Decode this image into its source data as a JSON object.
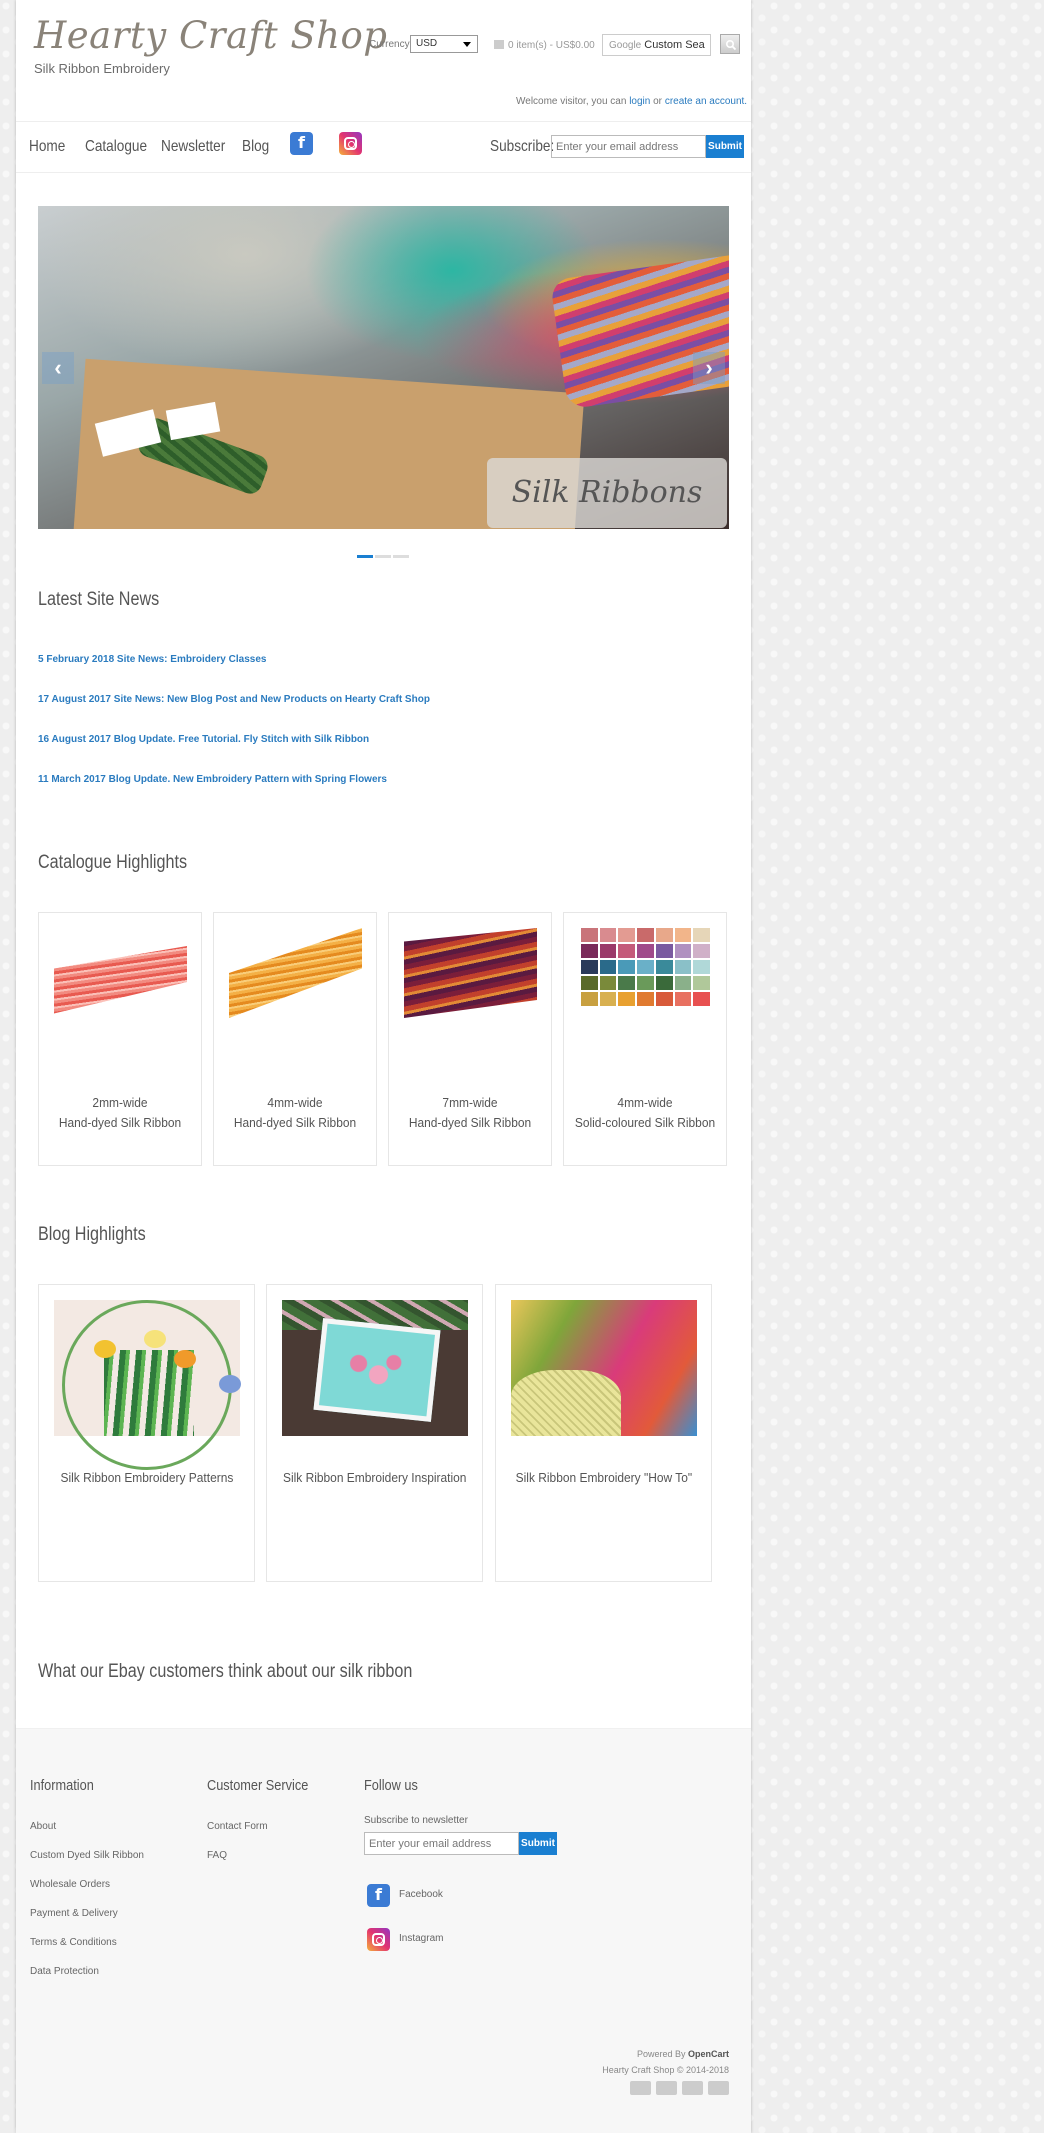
{
  "header": {
    "logo": "Hearty Craft Shop",
    "tagline": "Silk Ribbon Embroidery",
    "currency_label": "Currency:",
    "currency_value": "USD",
    "cart": "0 item(s) - US$0.00",
    "search_prefix": "Google",
    "search_value": "Custom Sea",
    "welcome_text": "Welcome visitor, you can",
    "login": "login",
    "or": "or",
    "create_account": "create an account."
  },
  "nav": {
    "items": [
      "Home",
      "Catalogue",
      "Newsletter",
      "Blog"
    ],
    "subscribe_label": "Subscribe:",
    "subscribe_placeholder": "Enter your email address",
    "subscribe_button": "Submit"
  },
  "slider": {
    "caption": "Silk Ribbons",
    "prev": "‹",
    "next": "›"
  },
  "news": {
    "title": "Latest Site News",
    "items": [
      "5  February 2018 Site News: Embroidery Classes",
      "17 August 2017 Site News: New Blog Post and New Products on Hearty Craft Shop",
      "16 August 2017 Blog Update. Free Tutorial. Fly Stitch with Silk Ribbon",
      "11 March 2017 Blog Update. New Embroidery Pattern with Spring Flowers"
    ]
  },
  "catalogue": {
    "title": "Catalogue Highlights",
    "items": [
      {
        "line1": "2mm-wide",
        "line2": "Hand-dyed Silk Ribbon"
      },
      {
        "line1": "4mm-wide",
        "line2": "Hand-dyed Silk Ribbon"
      },
      {
        "line1": "7mm-wide",
        "line2": "Hand-dyed Silk Ribbon"
      },
      {
        "line1": "4mm-wide",
        "line2": "Solid-coloured Silk Ribbon"
      }
    ]
  },
  "blog": {
    "title": "Blog Highlights",
    "items": [
      "Silk Ribbon Embroidery Patterns",
      "Silk Ribbon Embroidery Inspiration",
      "Silk Ribbon Embroidery \"How To\""
    ]
  },
  "ebay": {
    "title": "What our Ebay customers think about our silk ribbon"
  },
  "footer": {
    "information_title": "Information",
    "information_links": [
      "About",
      "Custom Dyed Silk Ribbon",
      "Wholesale Orders",
      "Payment & Delivery",
      "Terms & Conditions",
      "Data Protection"
    ],
    "service_title": "Customer Service",
    "service_links": [
      "Contact Form",
      "FAQ"
    ],
    "follow_title": "Follow us",
    "newsletter_label": "Subscribe to newsletter",
    "newsletter_placeholder": "Enter your email address",
    "newsletter_button": "Submit",
    "facebook": "Facebook",
    "instagram": "Instagram",
    "powered_by": "Powered By",
    "powered_name": "OpenCart",
    "copyright": "Hearty Craft Shop © 2014-2018"
  },
  "colors": {
    "accent": "#1a7fd1",
    "link": "#2a7bbf",
    "facebook": "#3b7bd4"
  },
  "swatches": [
    "#c9747a",
    "#d98b8f",
    "#e39b92",
    "#c96a6a",
    "#e8a88a",
    "#f2b58a",
    "#e6d6b8",
    "#7a2a5a",
    "#9b3a6a",
    "#c45a7a",
    "#a04a8a",
    "#7a5aa0",
    "#b090c0",
    "#d0b0c8",
    "#2a3a5a",
    "#2a6a8a",
    "#4a9ab8",
    "#6ab0c8",
    "#3a8a9a",
    "#8ac0c8",
    "#b0d8d8",
    "#5a6a2a",
    "#7a8a3a",
    "#4a7a4a",
    "#6a9a5a",
    "#3a6a3a",
    "#8ab08a",
    "#b0c89a",
    "#c8a040",
    "#d8b050",
    "#e8a030",
    "#e07a30",
    "#d85a3a",
    "#e87060",
    "#e85050"
  ]
}
